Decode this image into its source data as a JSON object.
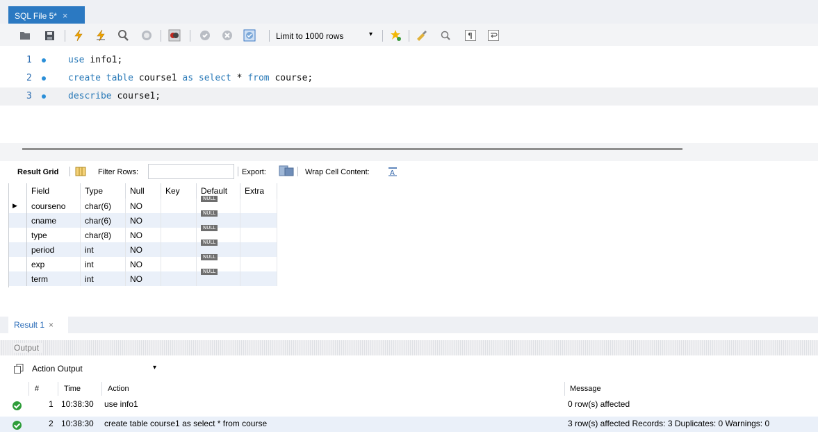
{
  "tab": {
    "title": "SQL File 5*",
    "close": "×"
  },
  "toolbar": {
    "limit_label": "Limit to 1000 rows"
  },
  "editor": {
    "lines": [
      {
        "num": "1",
        "text": "use info1;"
      },
      {
        "num": "2",
        "text": "create table course1 as select * from course;"
      },
      {
        "num": "3",
        "text": "describe course1;"
      }
    ]
  },
  "grid_toolbar": {
    "result_grid": "Result Grid",
    "filter_rows": "Filter Rows:",
    "export": "Export:",
    "wrap": "Wrap Cell Content:"
  },
  "grid": {
    "columns": [
      "Field",
      "Type",
      "Null",
      "Key",
      "Default",
      "Extra"
    ],
    "null_badge": "NULL",
    "rows": [
      {
        "field": "courseno",
        "type": "char(6)",
        "null": "NO"
      },
      {
        "field": "cname",
        "type": "char(6)",
        "null": "NO"
      },
      {
        "field": "type",
        "type": "char(8)",
        "null": "NO"
      },
      {
        "field": "period",
        "type": "int",
        "null": "NO"
      },
      {
        "field": "exp",
        "type": "int",
        "null": "NO"
      },
      {
        "field": "term",
        "type": "int",
        "null": "NO"
      }
    ]
  },
  "result_tab": {
    "label": "Result 1",
    "close": "×"
  },
  "output": {
    "title": "Output",
    "selector": "Action Output",
    "headers": {
      "num": "#",
      "time": "Time",
      "action": "Action",
      "message": "Message"
    },
    "rows": [
      {
        "num": "1",
        "time": "10:38:30",
        "action": "use info1",
        "message": "0 row(s) affected"
      },
      {
        "num": "2",
        "time": "10:38:30",
        "action": "create table course1 as select * from course",
        "message": "3 row(s) affected Records: 3  Duplicates: 0  Warnings: 0"
      }
    ]
  }
}
